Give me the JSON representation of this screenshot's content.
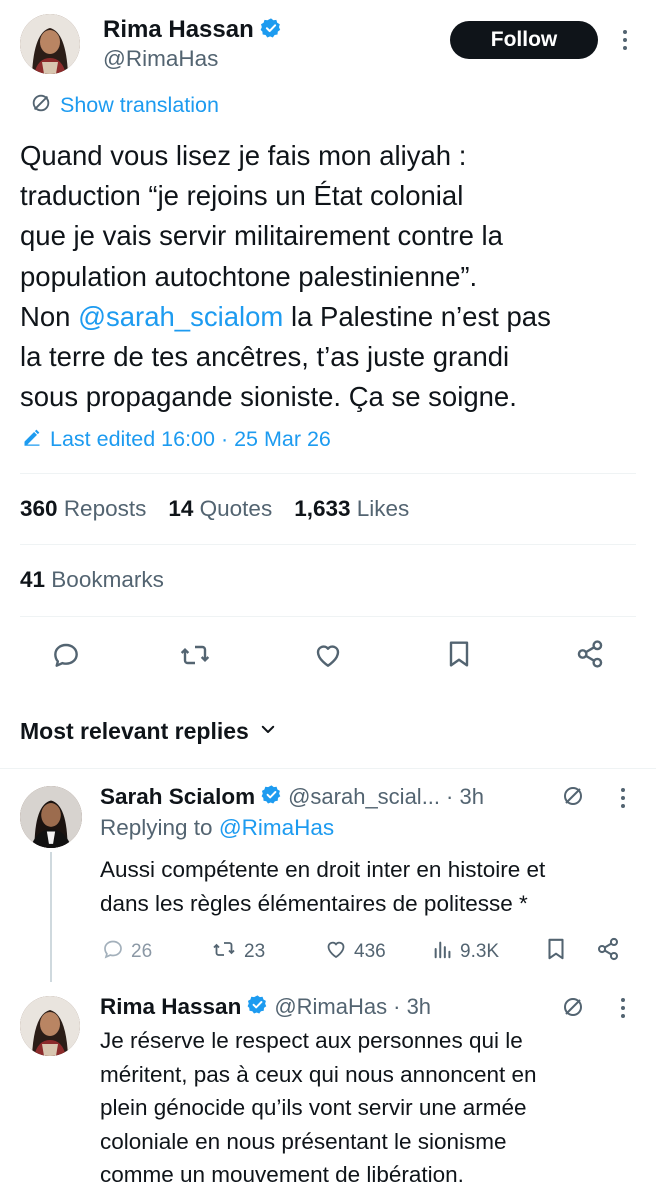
{
  "main_post": {
    "author_name": "Rima Hassan",
    "author_handle": "@RimaHas",
    "follow_label": "Follow",
    "show_translation": "Show translation",
    "text_lines": [
      "Quand vous lisez je fais mon aliyah :",
      "traduction “je rejoins un État colonial",
      "que je vais servir militairement contre la",
      "population autochtone palestinienne”.",
      "la terre de tes ancêtres, t’as juste grandi",
      "sous propagande sioniste. Ça se soigne."
    ],
    "line5_prefix": "Non ",
    "mention": "@sarah_scialom",
    "line5_suffix": " la Palestine n’est pas",
    "edited_label": "Last edited 16:00 · 25 Mar 26"
  },
  "stats": {
    "reposts_count": "360",
    "reposts_label": "Reposts",
    "quotes_count": "14",
    "quotes_label": "Quotes",
    "likes_count": "1,633",
    "likes_label": "Likes",
    "bookmarks_count": "41",
    "bookmarks_label": "Bookmarks"
  },
  "action_icons": [
    "reply-icon",
    "repost-icon",
    "like-icon",
    "bookmark-icon",
    "share-icon"
  ],
  "replies_sort_label": "Most relevant replies",
  "replies": [
    {
      "author_name": "Sarah Scialom",
      "author_handle": "@sarah_scial...",
      "time": "· 3h",
      "replying_prefix": "Replying to ",
      "replying_to": "@RimaHas",
      "text_lines": [
        "Aussi compétente en droit inter en histoire et",
        "dans les règles élémentaires de politesse *"
      ],
      "metrics": {
        "replies": "26",
        "reposts": "23",
        "likes": "436",
        "views": "9.3K"
      }
    },
    {
      "author_name": "Rima Hassan",
      "author_handle": "@RimaHas",
      "time": "· 3h",
      "text_lines": [
        "Je réserve le respect aux personnes qui le",
        "méritent, pas à ceux qui nous annoncent en",
        "plein génocide qu’ils vont servir une armée",
        "coloniale en nous présentant le sionisme",
        "comme un mouvement de libération."
      ]
    }
  ],
  "colors": {
    "text": "#0f1419",
    "muted": "#536471",
    "link": "#1d9bf0",
    "verified": "#1d9bf0",
    "divider": "#eff3f4"
  }
}
